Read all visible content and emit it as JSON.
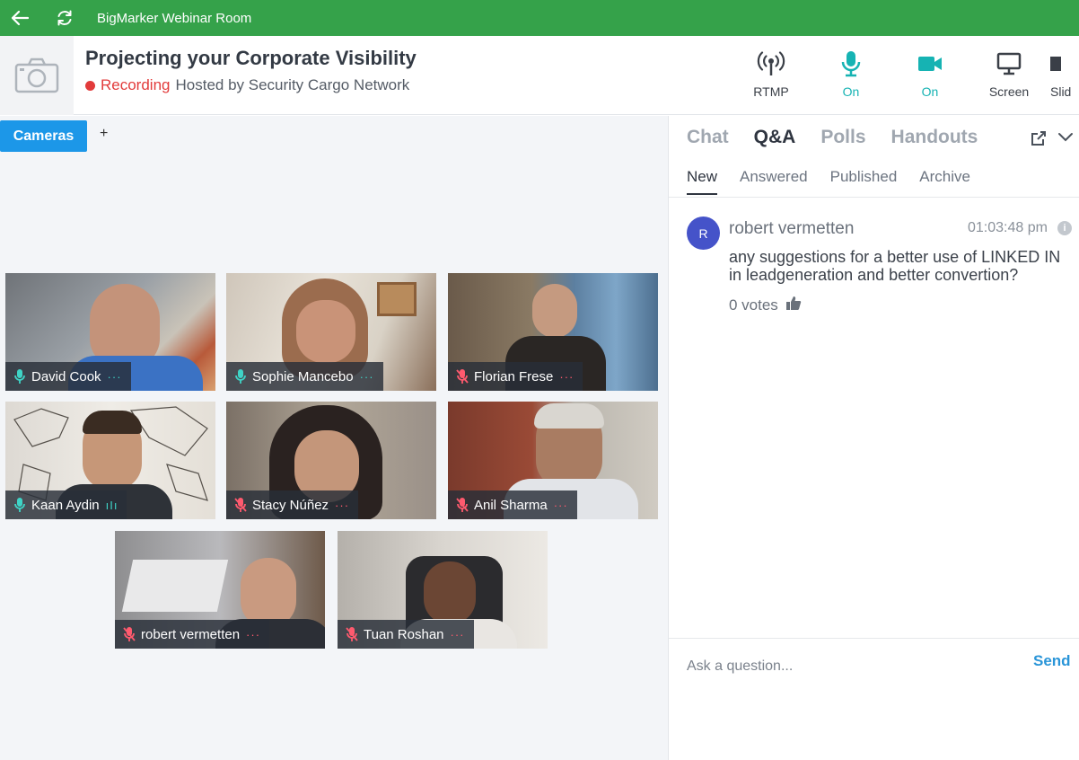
{
  "titlebar": {
    "title": "BigMarker Webinar Room",
    "icons": [
      "back-arrow-icon",
      "refresh-icon"
    ],
    "color": "#35a24a"
  },
  "header": {
    "event_title": "Projecting your Corporate Visibility",
    "recording_label": "Recording",
    "hosted_by": "Hosted by Security Cargo Network",
    "recording_color": "#e23b3b",
    "tools": [
      {
        "label": "RTMP",
        "icon": "broadcast-icon"
      },
      {
        "label": "On",
        "icon": "microphone-icon"
      },
      {
        "label": "On",
        "icon": "video-camera-icon"
      },
      {
        "label": "Screen",
        "icon": "monitor-icon"
      },
      {
        "label": "Slid",
        "icon": "slides-icon"
      }
    ],
    "on_color": "#16b3b3"
  },
  "stage": {
    "tabs": {
      "cameras": "Cameras",
      "add": "+"
    },
    "participants": [
      {
        "name": "David Cook",
        "mic": "on"
      },
      {
        "name": "Sophie Mancebo",
        "mic": "on"
      },
      {
        "name": "Florian Frese",
        "mic": "muted"
      },
      {
        "name": "Kaan Aydin",
        "mic": "on"
      },
      {
        "name": "Stacy Núñez",
        "mic": "muted"
      },
      {
        "name": "Anil Sharma",
        "mic": "muted"
      },
      {
        "name": "robert vermetten",
        "mic": "muted"
      },
      {
        "name": "Tuan Roshan",
        "mic": "muted"
      }
    ],
    "more_glyph": "···",
    "speaking_glyph": "ıIı"
  },
  "panel": {
    "main_tabs": [
      "Chat",
      "Q&A",
      "Polls",
      "Handouts"
    ],
    "active_main_tab": "Q&A",
    "sub_tabs": [
      "New",
      "Answered",
      "Published",
      "Archive"
    ],
    "active_sub_tab": "New",
    "question": {
      "avatar_initial": "R",
      "author": "robert vermetten",
      "time": "01:03:48 pm",
      "info": "i",
      "text": "any suggestions for a better use of LINKED IN in leadgeneration and better convertion?",
      "votes": "0 votes"
    },
    "ask": {
      "placeholder": "Ask a question...",
      "send": "Send"
    }
  }
}
